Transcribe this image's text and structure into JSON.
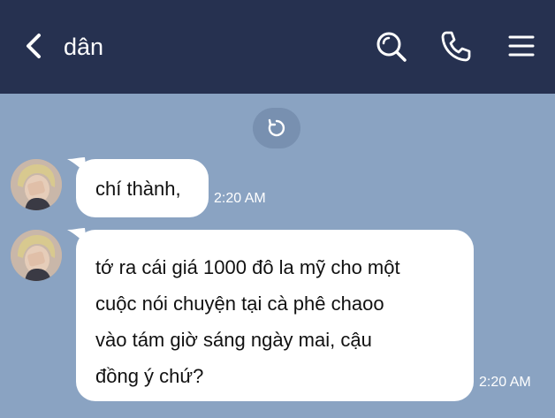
{
  "header": {
    "back_icon": "chevron-left-icon",
    "title": "dân",
    "search_icon": "search-icon",
    "call_icon": "phone-icon",
    "menu_icon": "hamburger-menu-icon",
    "background": "#263150"
  },
  "chat": {
    "background": "#8aa3c2",
    "refresh_icon": "refresh-icon",
    "messages": [
      {
        "text": "chí thành,",
        "time": "2:20 AM"
      },
      {
        "text": "tớ ra cái giá 1000 đô la mỹ cho một\ncuộc nói chuyện tại cà phê chaoo\nvào tám giờ sáng ngày mai, cậu\nđồng ý chứ?",
        "time": "2:20 AM"
      }
    ]
  }
}
